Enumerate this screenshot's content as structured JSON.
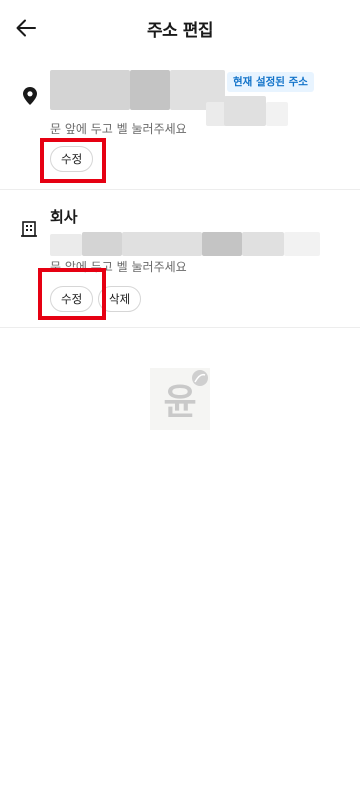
{
  "header": {
    "title": "주소 편집",
    "back_icon": "arrow-left-icon"
  },
  "addresses": [
    {
      "icon": "location-pin-icon",
      "name": "",
      "badge": "현재 설정된 주소",
      "memo": "문 앞에 두고 벨 눌러주세요",
      "edit_label": "수정"
    },
    {
      "icon": "building-icon",
      "name": "회사",
      "memo": "문 앞에 두고 벨 눌러주세요",
      "edit_label": "수정",
      "delete_label": "삭제"
    }
  ],
  "empty_logo": {
    "glyph": "윤",
    "icon": "leaf-icon"
  },
  "colors": {
    "accent_blue": "#1273c9",
    "badge_bg": "#e8f4ff",
    "highlight_red": "#e60012"
  }
}
